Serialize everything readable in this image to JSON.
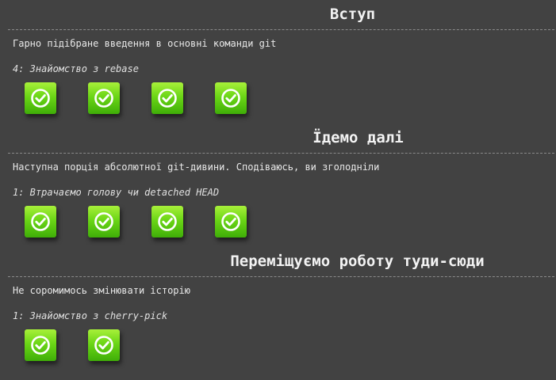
{
  "sections": [
    {
      "title": "Вступ",
      "description": "Гарно підібране введення в основні команди git",
      "current_level": "4: Знайомство з rebase",
      "levels": [
        {
          "status": "completed",
          "icon": "check-circle-icon"
        },
        {
          "status": "completed",
          "icon": "check-circle-icon"
        },
        {
          "status": "completed",
          "icon": "check-circle-icon"
        },
        {
          "status": "completed",
          "icon": "check-circle-icon"
        }
      ]
    },
    {
      "title": "Їдемо далі",
      "description": "Наступна порція абсолютної git-дивини. Сподіваюсь, ви зголодніли",
      "current_level": "1: Втрачаємо голову чи detached HEAD",
      "levels": [
        {
          "status": "completed",
          "icon": "check-circle-icon"
        },
        {
          "status": "completed",
          "icon": "check-circle-icon"
        },
        {
          "status": "completed",
          "icon": "check-circle-icon"
        },
        {
          "status": "completed",
          "icon": "check-circle-icon"
        }
      ]
    },
    {
      "title": "Переміщуємо роботу туди-сюди",
      "description": "Не соромимось змінювати історію",
      "current_level": "1: Знайомство з cherry-pick",
      "levels": [
        {
          "status": "completed",
          "icon": "check-circle-icon"
        },
        {
          "status": "completed",
          "icon": "check-circle-icon"
        }
      ]
    }
  ],
  "colors": {
    "background": "#424242",
    "level_completed": "#6bd616",
    "divider": "#8a8a8a"
  }
}
